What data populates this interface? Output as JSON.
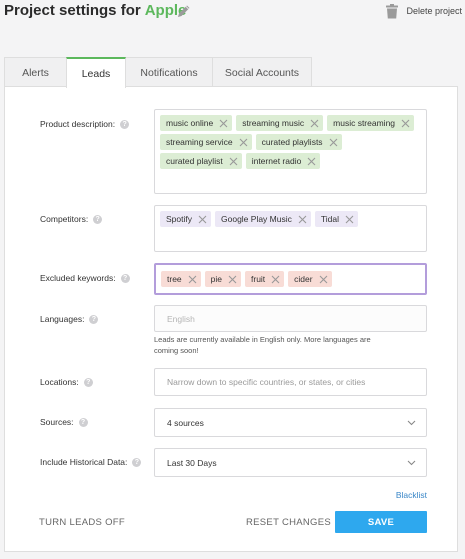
{
  "header": {
    "title_prefix": "Project settings for",
    "project_name": "Apple",
    "delete_label": "Delete project"
  },
  "tabs": [
    {
      "label": "Alerts"
    },
    {
      "label": "Leads"
    },
    {
      "label": "Notifications"
    },
    {
      "label": "Social Accounts"
    }
  ],
  "active_tab": "Leads",
  "form": {
    "product_description": {
      "label": "Product description:",
      "chips": [
        "music online",
        "streaming music",
        "music streaming",
        "streaming service",
        "curated playlists",
        "curated playlist",
        "internet radio"
      ]
    },
    "competitors": {
      "label": "Competitors:",
      "chips": [
        "Spotify",
        "Google Play Music",
        "Tidal"
      ]
    },
    "excluded_keywords": {
      "label": "Excluded keywords:",
      "chips": [
        "tree",
        "pie",
        "fruit",
        "cider"
      ]
    },
    "languages": {
      "label": "Languages:",
      "placeholder": "English",
      "note": "Leads are currently available in English only. More languages are coming soon!"
    },
    "locations": {
      "label": "Locations:",
      "placeholder": "Narrow down to specific countries, or states, or cities"
    },
    "sources": {
      "label": "Sources:",
      "value": "4 sources"
    },
    "historical": {
      "label": "Include Historical Data:",
      "value": "Last 30 Days"
    }
  },
  "links": {
    "blacklist": "Blacklist"
  },
  "buttons": {
    "turn_off": "TURN LEADS OFF",
    "reset": "RESET CHANGES",
    "save": "SAVE"
  },
  "colors": {
    "accent_green": "#5cb85c",
    "save_blue": "#2ea8ee",
    "focus_purple": "#b39ddb",
    "chip_green": "#dcedd4",
    "chip_purple": "#ece8f6",
    "chip_red": "#f8dcd6"
  }
}
